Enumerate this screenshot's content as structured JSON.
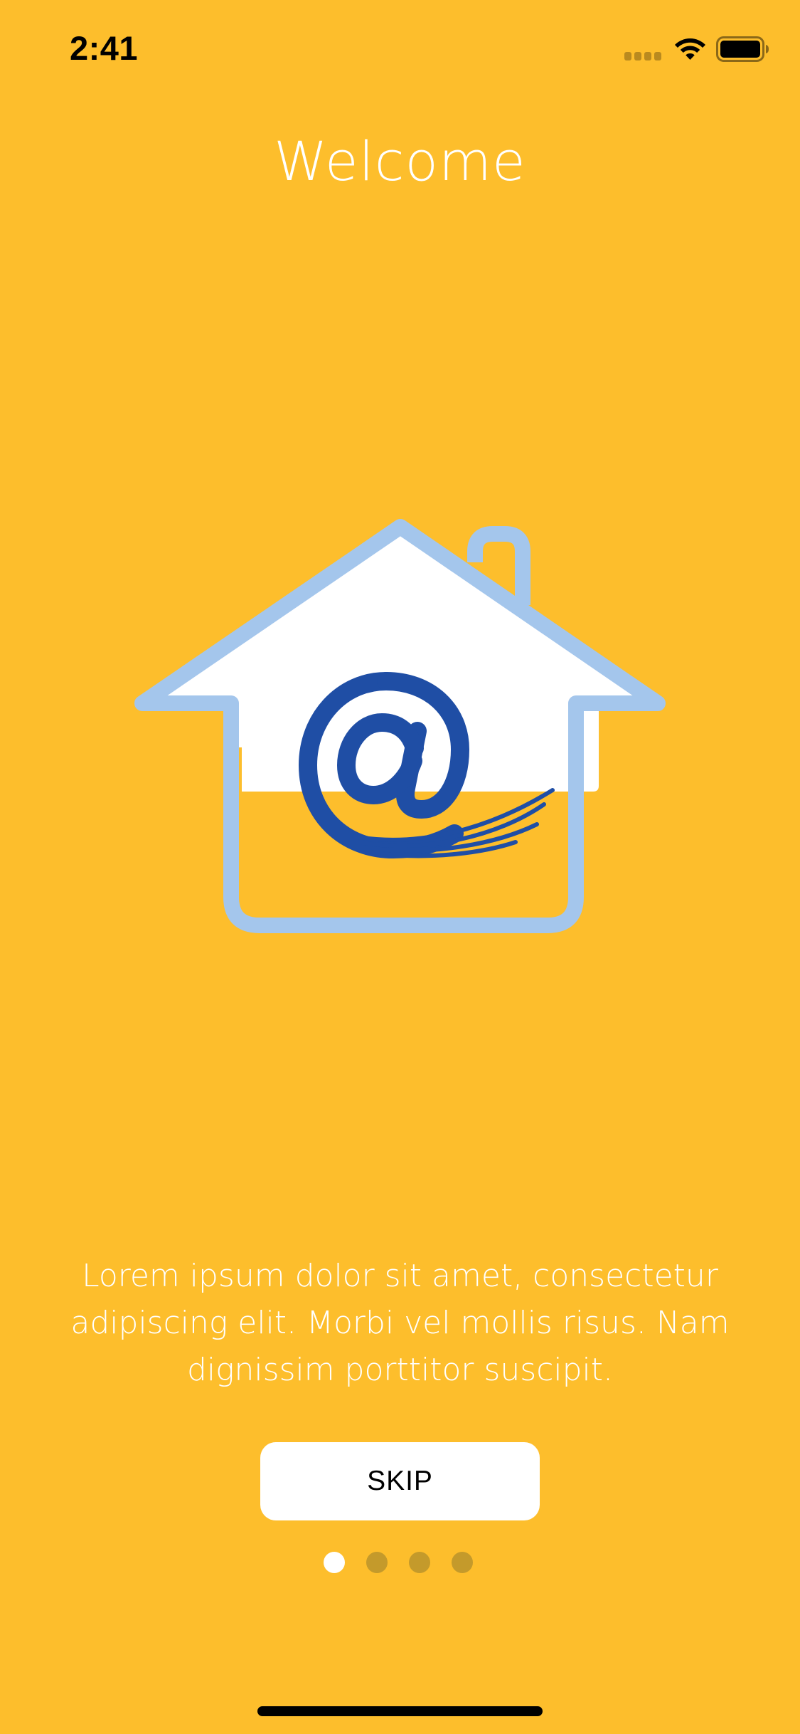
{
  "status_bar": {
    "time": "2:41"
  },
  "onboarding": {
    "title": "Welcome",
    "description": "Lorem ipsum dolor sit amet, consectetur adipiscing elit. Morbi vel mollis risus. Nam dignissim porttitor suscipit.",
    "illustration_icon": "house-email-icon",
    "skip_label": "SKIP",
    "page_indicator": {
      "total_pages": 4,
      "current_page": 1
    }
  },
  "colors": {
    "background": "#FDBE2C",
    "house_outline": "#A4C6EC",
    "at_symbol": "#1F4EA5",
    "text": "#FFFFFF",
    "dot_inactive": "#C49A2B"
  }
}
